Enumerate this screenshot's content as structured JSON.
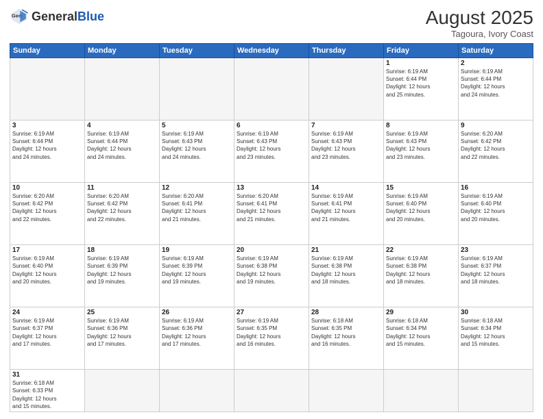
{
  "logo": {
    "text_general": "General",
    "text_blue": "Blue"
  },
  "header": {
    "month": "August 2025",
    "location": "Tagoura, Ivory Coast"
  },
  "weekdays": [
    "Sunday",
    "Monday",
    "Tuesday",
    "Wednesday",
    "Thursday",
    "Friday",
    "Saturday"
  ],
  "weeks": [
    [
      {
        "day": "",
        "info": ""
      },
      {
        "day": "",
        "info": ""
      },
      {
        "day": "",
        "info": ""
      },
      {
        "day": "",
        "info": ""
      },
      {
        "day": "",
        "info": ""
      },
      {
        "day": "1",
        "info": "Sunrise: 6:19 AM\nSunset: 6:44 PM\nDaylight: 12 hours\nand 25 minutes."
      },
      {
        "day": "2",
        "info": "Sunrise: 6:19 AM\nSunset: 6:44 PM\nDaylight: 12 hours\nand 24 minutes."
      }
    ],
    [
      {
        "day": "3",
        "info": "Sunrise: 6:19 AM\nSunset: 6:44 PM\nDaylight: 12 hours\nand 24 minutes."
      },
      {
        "day": "4",
        "info": "Sunrise: 6:19 AM\nSunset: 6:44 PM\nDaylight: 12 hours\nand 24 minutes."
      },
      {
        "day": "5",
        "info": "Sunrise: 6:19 AM\nSunset: 6:43 PM\nDaylight: 12 hours\nand 24 minutes."
      },
      {
        "day": "6",
        "info": "Sunrise: 6:19 AM\nSunset: 6:43 PM\nDaylight: 12 hours\nand 23 minutes."
      },
      {
        "day": "7",
        "info": "Sunrise: 6:19 AM\nSunset: 6:43 PM\nDaylight: 12 hours\nand 23 minutes."
      },
      {
        "day": "8",
        "info": "Sunrise: 6:19 AM\nSunset: 6:43 PM\nDaylight: 12 hours\nand 23 minutes."
      },
      {
        "day": "9",
        "info": "Sunrise: 6:20 AM\nSunset: 6:42 PM\nDaylight: 12 hours\nand 22 minutes."
      }
    ],
    [
      {
        "day": "10",
        "info": "Sunrise: 6:20 AM\nSunset: 6:42 PM\nDaylight: 12 hours\nand 22 minutes."
      },
      {
        "day": "11",
        "info": "Sunrise: 6:20 AM\nSunset: 6:42 PM\nDaylight: 12 hours\nand 22 minutes."
      },
      {
        "day": "12",
        "info": "Sunrise: 6:20 AM\nSunset: 6:41 PM\nDaylight: 12 hours\nand 21 minutes."
      },
      {
        "day": "13",
        "info": "Sunrise: 6:20 AM\nSunset: 6:41 PM\nDaylight: 12 hours\nand 21 minutes."
      },
      {
        "day": "14",
        "info": "Sunrise: 6:19 AM\nSunset: 6:41 PM\nDaylight: 12 hours\nand 21 minutes."
      },
      {
        "day": "15",
        "info": "Sunrise: 6:19 AM\nSunset: 6:40 PM\nDaylight: 12 hours\nand 20 minutes."
      },
      {
        "day": "16",
        "info": "Sunrise: 6:19 AM\nSunset: 6:40 PM\nDaylight: 12 hours\nand 20 minutes."
      }
    ],
    [
      {
        "day": "17",
        "info": "Sunrise: 6:19 AM\nSunset: 6:40 PM\nDaylight: 12 hours\nand 20 minutes."
      },
      {
        "day": "18",
        "info": "Sunrise: 6:19 AM\nSunset: 6:39 PM\nDaylight: 12 hours\nand 19 minutes."
      },
      {
        "day": "19",
        "info": "Sunrise: 6:19 AM\nSunset: 6:39 PM\nDaylight: 12 hours\nand 19 minutes."
      },
      {
        "day": "20",
        "info": "Sunrise: 6:19 AM\nSunset: 6:38 PM\nDaylight: 12 hours\nand 19 minutes."
      },
      {
        "day": "21",
        "info": "Sunrise: 6:19 AM\nSunset: 6:38 PM\nDaylight: 12 hours\nand 18 minutes."
      },
      {
        "day": "22",
        "info": "Sunrise: 6:19 AM\nSunset: 6:38 PM\nDaylight: 12 hours\nand 18 minutes."
      },
      {
        "day": "23",
        "info": "Sunrise: 6:19 AM\nSunset: 6:37 PM\nDaylight: 12 hours\nand 18 minutes."
      }
    ],
    [
      {
        "day": "24",
        "info": "Sunrise: 6:19 AM\nSunset: 6:37 PM\nDaylight: 12 hours\nand 17 minutes."
      },
      {
        "day": "25",
        "info": "Sunrise: 6:19 AM\nSunset: 6:36 PM\nDaylight: 12 hours\nand 17 minutes."
      },
      {
        "day": "26",
        "info": "Sunrise: 6:19 AM\nSunset: 6:36 PM\nDaylight: 12 hours\nand 17 minutes."
      },
      {
        "day": "27",
        "info": "Sunrise: 6:19 AM\nSunset: 6:35 PM\nDaylight: 12 hours\nand 16 minutes."
      },
      {
        "day": "28",
        "info": "Sunrise: 6:18 AM\nSunset: 6:35 PM\nDaylight: 12 hours\nand 16 minutes."
      },
      {
        "day": "29",
        "info": "Sunrise: 6:18 AM\nSunset: 6:34 PM\nDaylight: 12 hours\nand 15 minutes."
      },
      {
        "day": "30",
        "info": "Sunrise: 6:18 AM\nSunset: 6:34 PM\nDaylight: 12 hours\nand 15 minutes."
      }
    ],
    [
      {
        "day": "31",
        "info": "Sunrise: 6:18 AM\nSunset: 6:33 PM\nDaylight: 12 hours\nand 15 minutes."
      },
      {
        "day": "",
        "info": ""
      },
      {
        "day": "",
        "info": ""
      },
      {
        "day": "",
        "info": ""
      },
      {
        "day": "",
        "info": ""
      },
      {
        "day": "",
        "info": ""
      },
      {
        "day": "",
        "info": ""
      }
    ]
  ]
}
